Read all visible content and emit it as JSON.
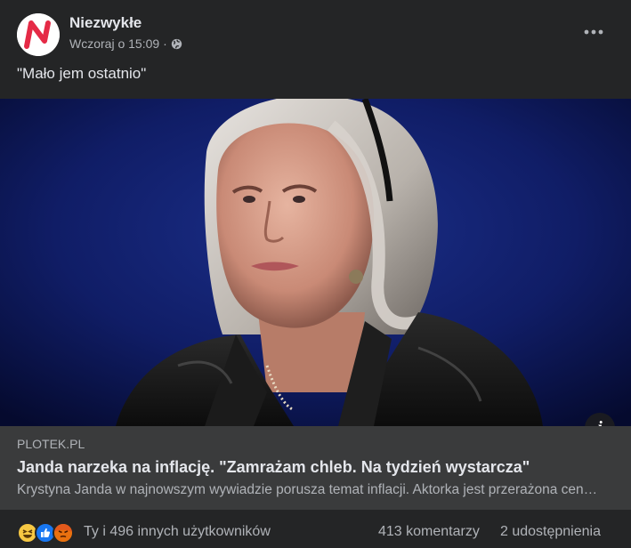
{
  "post": {
    "page_name": "Niezwykłe",
    "timestamp": "Wczoraj o 15:09",
    "separator": "·",
    "more_icon": "more-horizontal-icon",
    "text": "\"Mało jem ostatnio\""
  },
  "photo": {
    "info_label": "i"
  },
  "link": {
    "domain": "PLOTEK.PL",
    "title": "Janda narzeka na inflację. \"Zamrażam chleb. Na tydzień wystarcza\"",
    "description": "Krystyna Janda w najnowszym wywiadzie porusza temat inflacji. Aktorka jest przerażona cenami i nie ukrywa, że oszczędza."
  },
  "footer": {
    "reactions": [
      "haha-icon",
      "like-icon",
      "angry-icon"
    ],
    "reactions_text": "Ty i 496 innych użytkowników",
    "comments": "413 komentarzy",
    "shares": "2 udostępnienia"
  },
  "colors": {
    "background": "#242526",
    "link_box": "#3a3b3c",
    "text_primary": "#e4e6eb",
    "text_secondary": "#b0b3b8",
    "logo_red": "#e52a46",
    "like_blue": "#1877f2"
  }
}
